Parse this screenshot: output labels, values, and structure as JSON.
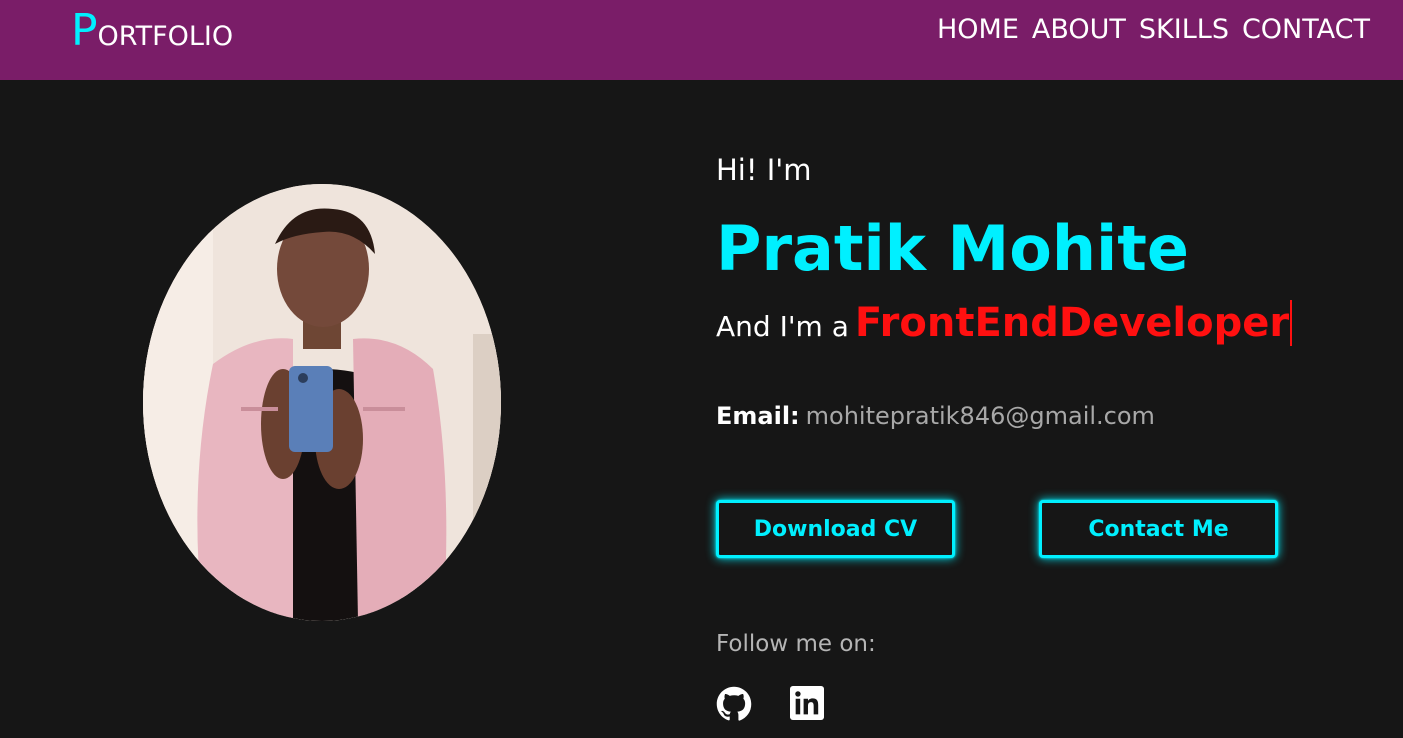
{
  "navbar": {
    "logo_first_letter": "P",
    "logo_rest": "ORTFOLIO",
    "links": [
      "HOME",
      "ABOUT",
      "SKILLS",
      "CONTACT"
    ]
  },
  "hero": {
    "greeting": "Hi! I'm",
    "name": "Pratik Mohite",
    "role_prefix": "And I'm a",
    "role_typed": "FrontEndDeveloper",
    "email_label": "Email:",
    "email_value": "mohitepratik846@gmail.com",
    "download_button": "Download CV",
    "contact_button": "Contact Me",
    "follow_text": "Follow me on:",
    "social_icons": [
      "github-icon",
      "linkedin-icon"
    ]
  },
  "colors": {
    "navbar_bg": "#7a1d68",
    "page_bg": "#161616",
    "accent_cyan": "#00f0ff",
    "accent_red": "#ff1010"
  }
}
